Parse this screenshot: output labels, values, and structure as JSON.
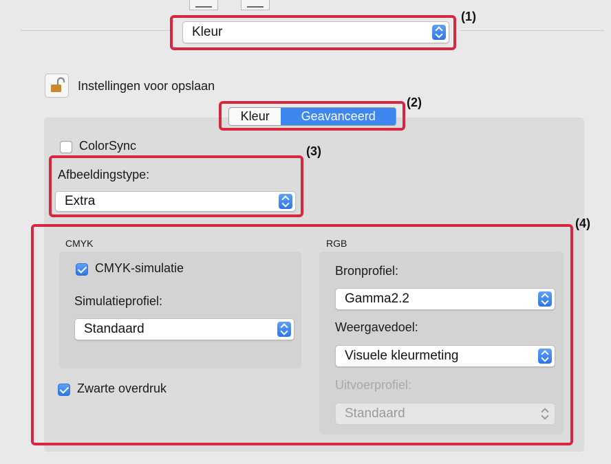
{
  "main_menu": {
    "value": "Kleur"
  },
  "save_settings": {
    "label": "Instellingen voor opslaan"
  },
  "tabs": [
    {
      "label": "Kleur",
      "selected": false
    },
    {
      "label": "Geavanceerd",
      "selected": true
    }
  ],
  "colorsync": {
    "label": "ColorSync",
    "checked": false
  },
  "image_type": {
    "label": "Afbeeldingstype:",
    "value": "Extra"
  },
  "cmyk": {
    "section_title": "CMYK",
    "simulation": {
      "label": "CMYK-simulatie",
      "checked": true
    },
    "profile_label": "Simulatieprofiel:",
    "profile_value": "Standaard"
  },
  "black_overprint": {
    "label": "Zwarte overdruk",
    "checked": true
  },
  "rgb": {
    "section_title": "RGB",
    "source_label": "Bronprofiel:",
    "source_value": "Gamma2.2",
    "intent_label": "Weergavedoel:",
    "intent_value": "Visuele kleurmeting",
    "output_label": "Uitvoerprofiel:",
    "output_value": "Standaard"
  },
  "callouts": [
    "(1)",
    "(2)",
    "(3)",
    "(4)"
  ],
  "colors": {
    "annotation_red": "#d7263d",
    "accent_blue": "#3d87ef"
  }
}
